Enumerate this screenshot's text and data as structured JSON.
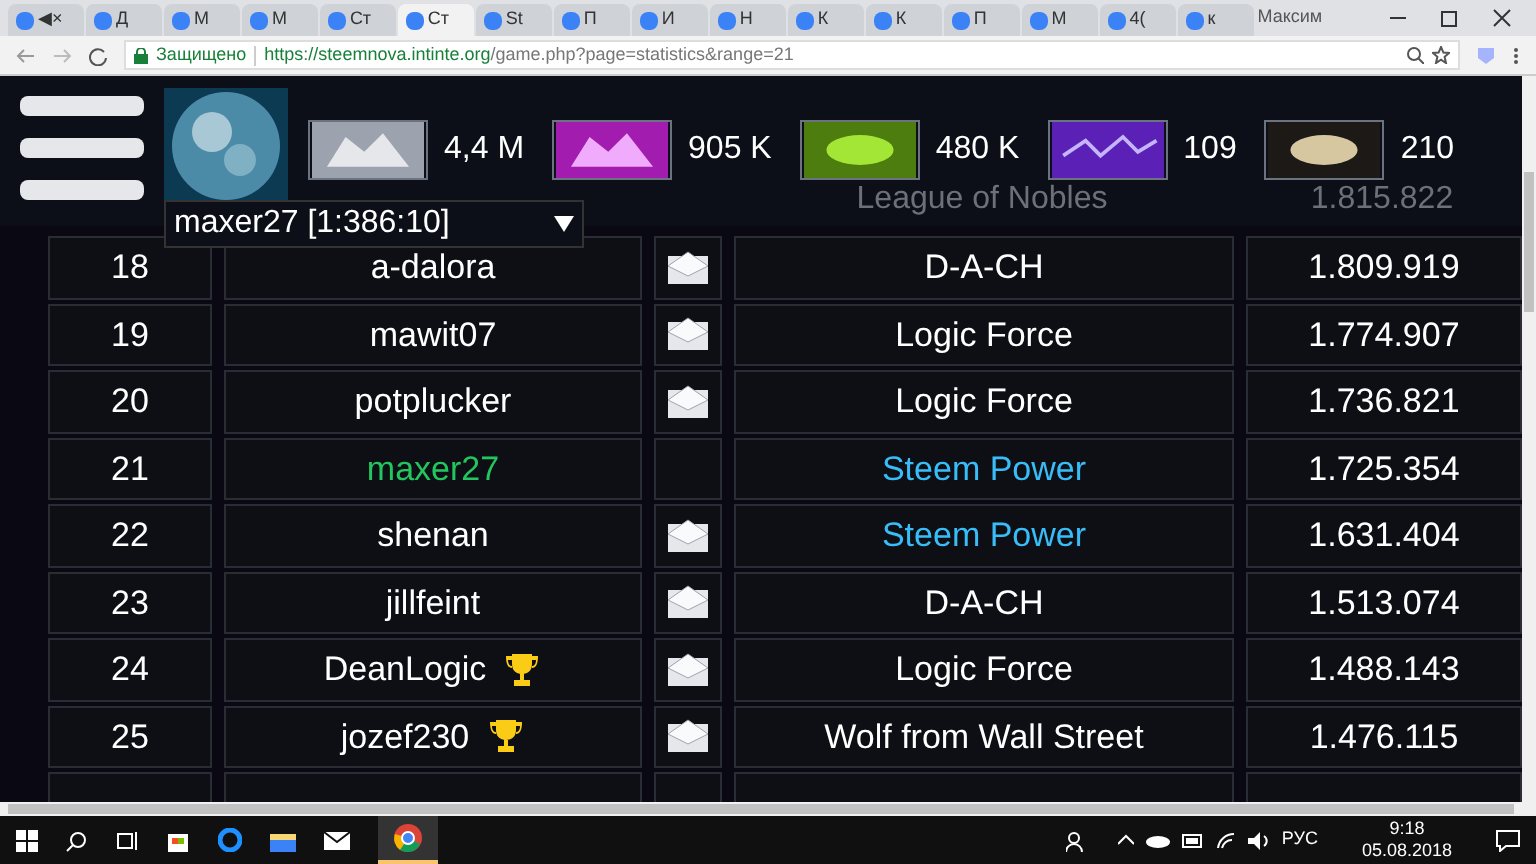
{
  "browser": {
    "tabs": [
      {
        "label": "◀×",
        "selected": false
      },
      {
        "label": "Д",
        "selected": false
      },
      {
        "label": "М",
        "selected": false
      },
      {
        "label": "М",
        "selected": false
      },
      {
        "label": "Ст",
        "selected": false
      },
      {
        "label": "Ст",
        "selected": true
      },
      {
        "label": "St",
        "selected": false
      },
      {
        "label": "П",
        "selected": false
      },
      {
        "label": "И",
        "selected": false
      },
      {
        "label": "Н",
        "selected": false
      },
      {
        "label": "К",
        "selected": false
      },
      {
        "label": "К",
        "selected": false
      },
      {
        "label": "П",
        "selected": false
      },
      {
        "label": "М",
        "selected": false
      },
      {
        "label": "4(",
        "selected": false
      },
      {
        "label": "к",
        "selected": false
      }
    ],
    "user": "Максим",
    "secure_label": "Защищено",
    "url_host": "https://steemnova.intinte.org",
    "url_path": "/game.php?page=statistics&range=21"
  },
  "header": {
    "resources": [
      {
        "kind": "metal",
        "value": "4,4 M"
      },
      {
        "kind": "crystal",
        "value": "905 K"
      },
      {
        "kind": "deuterium",
        "value": "480 K"
      },
      {
        "kind": "energy",
        "value": "109"
      },
      {
        "kind": "darkmatter",
        "value": "210"
      }
    ],
    "planet_select": "maxer27 [1:386:10]"
  },
  "hidden_row": {
    "alliance": "League of Nobles",
    "points": "1.815.822"
  },
  "rows": [
    {
      "rank": "18",
      "name": "a-dalora",
      "trophy": false,
      "mail": true,
      "alliance": "D-A-CH",
      "points": "1.809.919",
      "own": false,
      "same_alliance": false
    },
    {
      "rank": "19",
      "name": "mawit07",
      "trophy": false,
      "mail": true,
      "alliance": "Logic Force",
      "points": "1.774.907",
      "own": false,
      "same_alliance": false
    },
    {
      "rank": "20",
      "name": "potplucker",
      "trophy": false,
      "mail": true,
      "alliance": "Logic Force",
      "points": "1.736.821",
      "own": false,
      "same_alliance": false
    },
    {
      "rank": "21",
      "name": "maxer27",
      "trophy": false,
      "mail": false,
      "alliance": "Steem Power",
      "points": "1.725.354",
      "own": true,
      "same_alliance": true
    },
    {
      "rank": "22",
      "name": "shenan",
      "trophy": false,
      "mail": true,
      "alliance": "Steem Power",
      "points": "1.631.404",
      "own": false,
      "same_alliance": true
    },
    {
      "rank": "23",
      "name": "jillfeint",
      "trophy": false,
      "mail": true,
      "alliance": "D-A-CH",
      "points": "1.513.074",
      "own": false,
      "same_alliance": false
    },
    {
      "rank": "24",
      "name": "DeanLogic",
      "trophy": true,
      "mail": true,
      "alliance": "Logic Force",
      "points": "1.488.143",
      "own": false,
      "same_alliance": false
    },
    {
      "rank": "25",
      "name": "jozef230",
      "trophy": true,
      "mail": true,
      "alliance": "Wolf from Wall Street",
      "points": "1.476.115",
      "own": false,
      "same_alliance": false
    }
  ],
  "taskbar": {
    "language": "РУС",
    "time": "9:18",
    "date": "05.08.2018"
  }
}
